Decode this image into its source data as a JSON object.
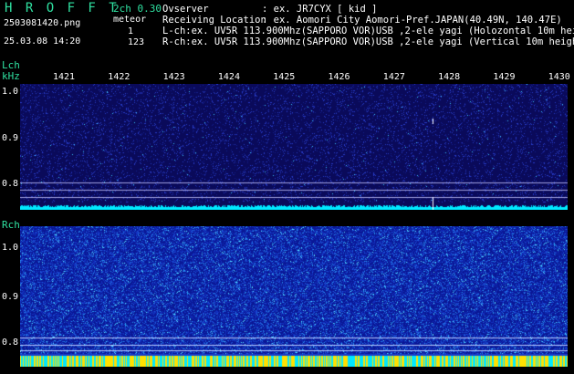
{
  "header": {
    "logo": "H R O F F T",
    "version": "2ch 0.30",
    "filename": "2503081420.png",
    "datetime": "25.03.08 14:20",
    "meteor_label": "meteor",
    "meteor_l": "1",
    "meteor_r": "123"
  },
  "info": {
    "observer_label": "Ovserver",
    "observer_value": ": ex. JR7CYX [ kid ]",
    "location_label": "Receiving Location",
    "location_value": ": ex. Aomori City Aomori-Pref.JAPAN(40.49N, 140.47E)",
    "lch_line": "L-ch:ex. UV5R 113.900Mhz(SAPPORO VOR)USB ,2-ele yagi (Holozontal 10m height)",
    "rch_line": "R-ch:ex. UV5R 113.900Mhz(SAPPORO VOR)USB ,2-ele yagi (Vertical 10m height)"
  },
  "lch": {
    "label": "Lch",
    "unit": "kHz",
    "y_ticks": [
      "1.0",
      "0.9",
      "0.8"
    ]
  },
  "rch": {
    "label": "Rch",
    "y_ticks": [
      "1.0",
      "0.9",
      "0.8"
    ]
  },
  "time_ticks": [
    "1421",
    "1422",
    "1423",
    "1424",
    "1425",
    "1426",
    "1427",
    "1428",
    "1429",
    "1430"
  ],
  "colors": {
    "accent": "#2fe0a0",
    "lch_bg": "#0a0a5a",
    "rch_bg": "#1a3ac8",
    "baseline_cyan": "#00e8ff",
    "baseline_yellow": "#ffe000"
  }
}
